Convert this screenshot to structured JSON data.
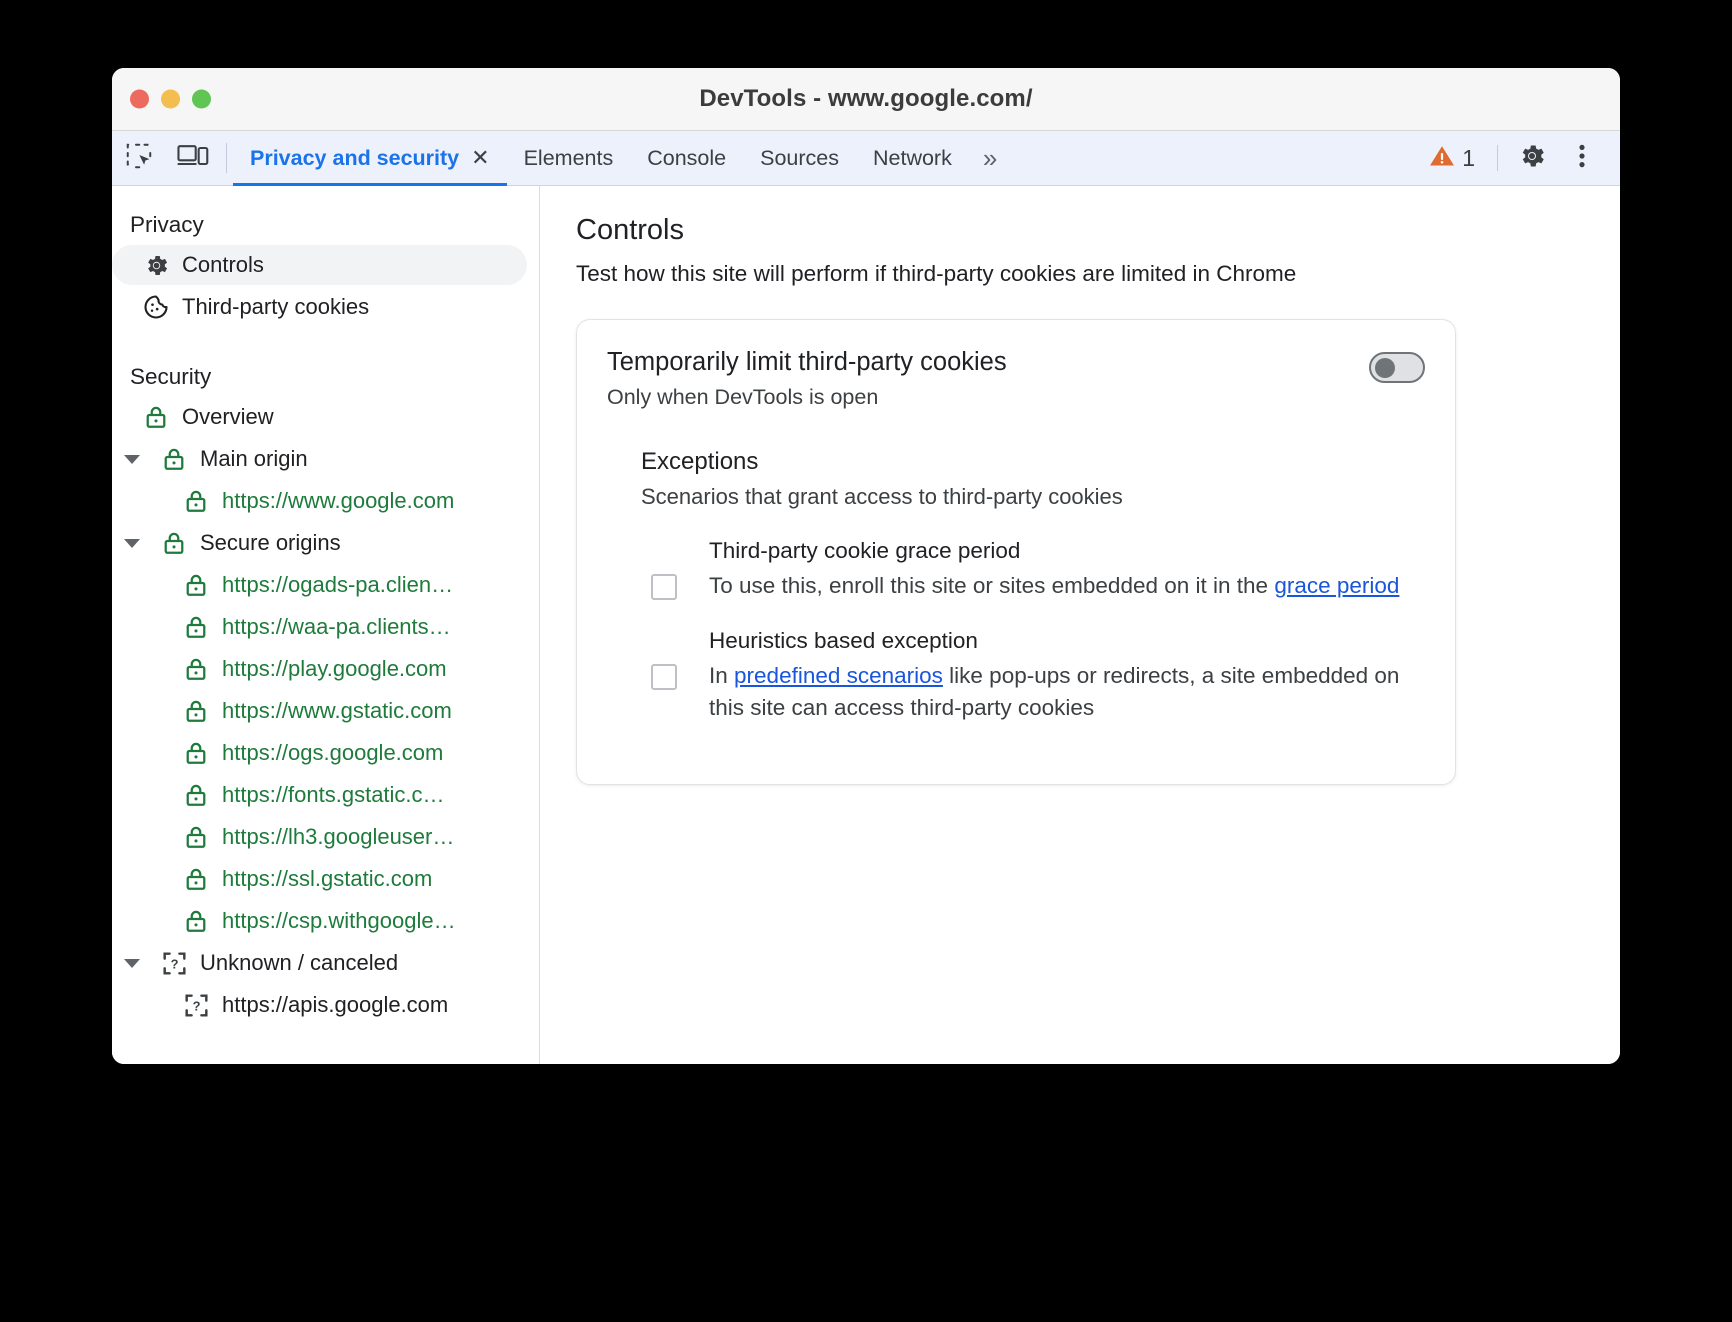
{
  "window": {
    "title": "DevTools - www.google.com/",
    "traffic_lights": [
      "close-red",
      "minimize-yellow",
      "maximize-green"
    ]
  },
  "tabstrip": {
    "inspect_icon": "inspect-element-icon",
    "device_icon": "device-toolbar-icon",
    "tabs": [
      {
        "label": "Privacy and security",
        "active": true,
        "closable": true,
        "close_glyph": "✕"
      },
      {
        "label": "Elements",
        "active": false
      },
      {
        "label": "Console",
        "active": false
      },
      {
        "label": "Sources",
        "active": false
      },
      {
        "label": "Network",
        "active": false
      }
    ],
    "more_tabs_glyph": "»",
    "warning_icon": "warning-triangle-icon",
    "warning_count": "1",
    "settings_icon": "gear-icon",
    "more_options_icon": "vertical-dots-icon"
  },
  "sidebar": {
    "groups": [
      {
        "header": "Privacy",
        "items": [
          {
            "label": "Controls",
            "icon": "gear-icon",
            "selected": true,
            "indent": 1
          },
          {
            "label": "Third-party cookies",
            "icon": "cookie-icon",
            "selected": false,
            "indent": 1
          }
        ]
      },
      {
        "header": "Security",
        "items": [
          {
            "label": "Overview",
            "icon": "lock-icon",
            "selected": false,
            "indent": 1
          },
          {
            "label": "Main origin",
            "icon": "lock-icon",
            "selected": false,
            "indent": 0,
            "expanded": true
          },
          {
            "label": "https://www.google.com",
            "icon": "lock-icon",
            "selected": false,
            "indent": 2,
            "url": true
          },
          {
            "label": "Secure origins",
            "icon": "lock-icon",
            "selected": false,
            "indent": 0,
            "expanded": true
          },
          {
            "label": "https://ogads-pa.clien…",
            "icon": "lock-icon",
            "selected": false,
            "indent": 2,
            "url": true
          },
          {
            "label": "https://waa-pa.clients…",
            "icon": "lock-icon",
            "selected": false,
            "indent": 2,
            "url": true
          },
          {
            "label": "https://play.google.com",
            "icon": "lock-icon",
            "selected": false,
            "indent": 2,
            "url": true
          },
          {
            "label": "https://www.gstatic.com",
            "icon": "lock-icon",
            "selected": false,
            "indent": 2,
            "url": true
          },
          {
            "label": "https://ogs.google.com",
            "icon": "lock-icon",
            "selected": false,
            "indent": 2,
            "url": true
          },
          {
            "label": "https://fonts.gstatic.c…",
            "icon": "lock-icon",
            "selected": false,
            "indent": 2,
            "url": true
          },
          {
            "label": "https://lh3.googleuser…",
            "icon": "lock-icon",
            "selected": false,
            "indent": 2,
            "url": true
          },
          {
            "label": "https://ssl.gstatic.com",
            "icon": "lock-icon",
            "selected": false,
            "indent": 2,
            "url": true
          },
          {
            "label": "https://csp.withgoogle…",
            "icon": "lock-icon",
            "selected": false,
            "indent": 2,
            "url": true
          },
          {
            "label": "Unknown / canceled",
            "icon": "unknown-square-icon",
            "selected": false,
            "indent": 0,
            "expanded": true
          },
          {
            "label": "https://apis.google.com",
            "icon": "unknown-square-icon",
            "selected": false,
            "indent": 2,
            "url": false
          }
        ]
      }
    ]
  },
  "main": {
    "title": "Controls",
    "subtitle": "Test how this site will perform if third-party cookies are limited in Chrome",
    "card": {
      "title": "Temporarily limit third-party cookies",
      "subtitle": "Only when DevTools is open",
      "toggle": {
        "name": "limit-third-party-cookies-toggle",
        "on": false
      },
      "exceptions": {
        "title": "Exceptions",
        "subtitle": "Scenarios that grant access to third-party cookies",
        "items": [
          {
            "title": "Third-party cookie grace period",
            "checked": false,
            "desc_before": "To use this, enroll this site or sites embedded on it in the ",
            "link": "grace period",
            "desc_after": ""
          },
          {
            "title": "Heuristics based exception",
            "checked": false,
            "desc_before": "In ",
            "link": "predefined scenarios",
            "desc_after": " like pop-ups or redirects, a site embedded on this site can access third-party cookies"
          }
        ]
      }
    }
  },
  "colors": {
    "accent_blue": "#1a73e8",
    "link_blue": "#1a56db",
    "secure_green": "#1e7b3c",
    "warning_orange": "#e06a30",
    "tabstrip_bg": "#edf1fb",
    "selected_pill": "#f1f3f4"
  }
}
